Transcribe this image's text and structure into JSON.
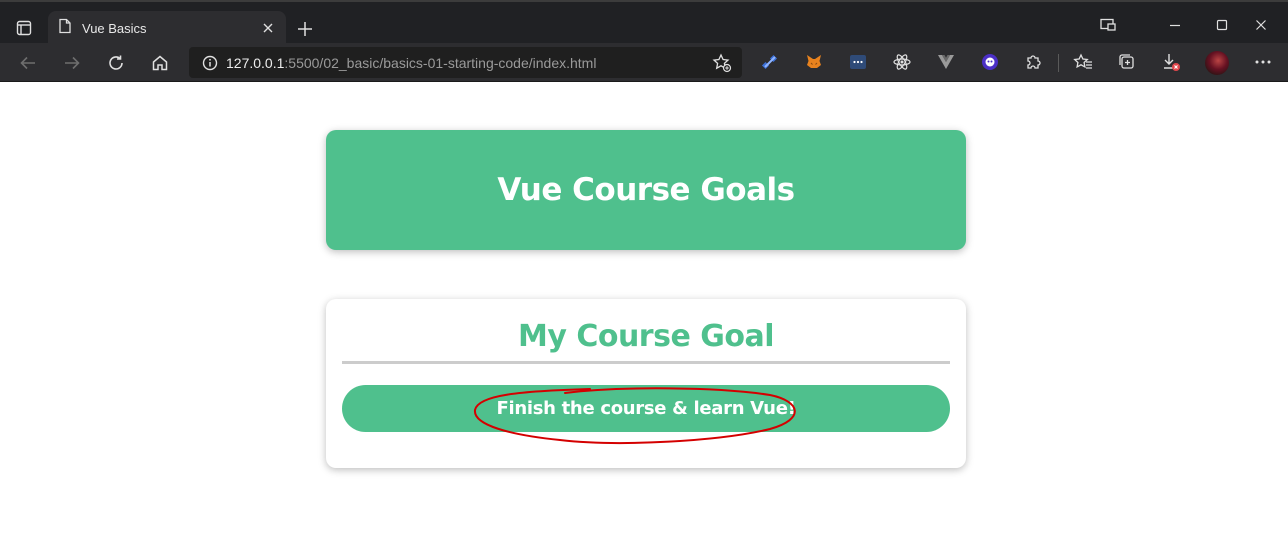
{
  "browser": {
    "tab": {
      "title": "Vue Basics"
    },
    "address": {
      "host": "127.0.0.1",
      "path": ":5500/02_basic/basics-01-starting-code/index.html"
    }
  },
  "page": {
    "header_title": "Vue Course Goals",
    "goal_title": "My Course Goal",
    "goal_text": "Finish the course & learn Vue!"
  },
  "colors": {
    "accent": "#4fc08d",
    "annotation": "#d40000"
  }
}
